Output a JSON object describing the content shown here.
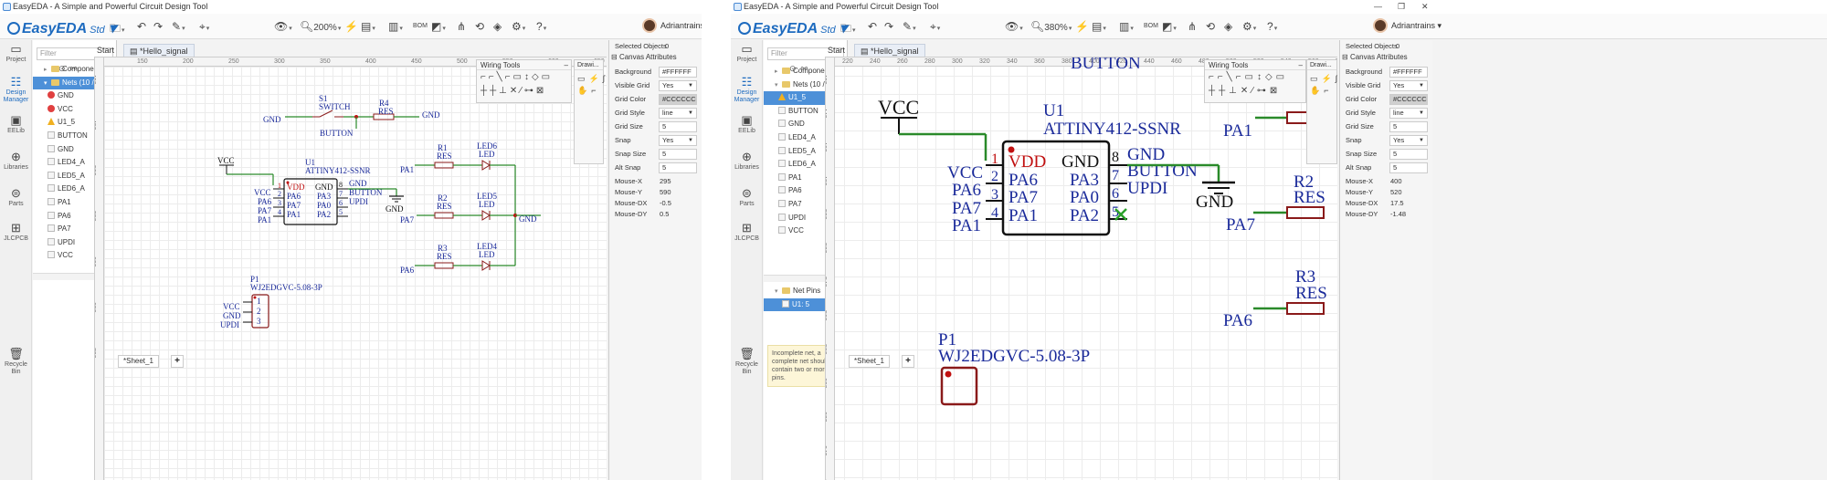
{
  "title": "EasyEDA - A Simple and Powerful Circuit Design Tool",
  "logo": {
    "name": "EasyEDA",
    "edition": "Std"
  },
  "toolbar": {
    "left_zoom": "200%",
    "right_zoom": "380%",
    "bom": "BOM"
  },
  "user": "Adriantrains",
  "nav": [
    {
      "label": "Project",
      "icon": "folder-icon"
    },
    {
      "label": "Design Manager",
      "icon": "design-manager-icon"
    },
    {
      "label": "EELib",
      "icon": "chip-icon"
    },
    {
      "label": "Libraries",
      "icon": "search-icon"
    },
    {
      "label": "Parts",
      "icon": "parts-icon"
    },
    {
      "label": "JLCPCB",
      "icon": "jlcpcb-icon"
    },
    {
      "label": "Recycle Bin",
      "icon": "trash-icon"
    }
  ],
  "filter_placeholder": "Filter",
  "left": {
    "components": "Components (10)",
    "nets": "Nets (10 / 13)",
    "net_items": [
      {
        "label": "GND",
        "state": "error"
      },
      {
        "label": "VCC",
        "state": "error"
      },
      {
        "label": "U1_5",
        "state": "warn"
      },
      {
        "label": "BUTTON",
        "state": ""
      },
      {
        "label": "GND",
        "state": ""
      },
      {
        "label": "LED4_A",
        "state": ""
      },
      {
        "label": "LED5_A",
        "state": ""
      },
      {
        "label": "LED6_A",
        "state": ""
      },
      {
        "label": "PA1",
        "state": ""
      },
      {
        "label": "PA6",
        "state": ""
      },
      {
        "label": "PA7",
        "state": ""
      },
      {
        "label": "UPDI",
        "state": ""
      },
      {
        "label": "VCC",
        "state": ""
      }
    ]
  },
  "right": {
    "components": "Components (10)",
    "nets": "Nets (10 / 11)",
    "net_items": [
      {
        "label": "U1_5",
        "state": "warn",
        "selected": true
      },
      {
        "label": "BUTTON",
        "state": ""
      },
      {
        "label": "GND",
        "state": ""
      },
      {
        "label": "LED4_A",
        "state": ""
      },
      {
        "label": "LED5_A",
        "state": ""
      },
      {
        "label": "LED6_A",
        "state": ""
      },
      {
        "label": "PA1",
        "state": ""
      },
      {
        "label": "PA6",
        "state": ""
      },
      {
        "label": "PA7",
        "state": ""
      },
      {
        "label": "UPDI",
        "state": ""
      },
      {
        "label": "VCC",
        "state": ""
      }
    ],
    "net_pins": "Net Pins",
    "net_pin_item": "U1: 5",
    "warning": "Incomplete net, a complete net should contain two or more pins."
  },
  "tabs": {
    "start": "Start",
    "doc": "*Hello_signal"
  },
  "sheet": "*Sheet_1",
  "panels": {
    "wiring_tools": "Wiring Tools",
    "drawing_tools": "Drawi..."
  },
  "props": {
    "selected_label": "Selected Objects",
    "selected_value": "0",
    "canvas_attrs": "Canvas Attributes",
    "rows": [
      {
        "label": "Background",
        "value": "#FFFFFF"
      },
      {
        "label": "Visible Grid",
        "value": "Yes"
      },
      {
        "label": "Grid Color",
        "value": "#CCCCCC"
      },
      {
        "label": "Grid Style",
        "value": "line"
      },
      {
        "label": "Grid Size",
        "value": "5"
      },
      {
        "label": "Snap",
        "value": "Yes"
      },
      {
        "label": "Snap Size",
        "value": "5"
      },
      {
        "label": "Alt Snap",
        "value": "5"
      }
    ],
    "mouse_labels": [
      "Mouse-X",
      "Mouse-Y",
      "Mouse-DX",
      "Mouse-DY"
    ],
    "left_mouse": [
      "295",
      "590",
      "-0.5",
      "0.5"
    ],
    "right_mouse": [
      "400",
      "520",
      "17.5",
      "-1.48"
    ]
  },
  "rulers": {
    "left_h": [
      "150",
      "200",
      "250",
      "300",
      "350",
      "400",
      "450",
      "500",
      "550",
      "600",
      "650"
    ],
    "left_v": [
      "400",
      "450",
      "500",
      "550",
      "600",
      "650",
      "700"
    ],
    "right_h": [
      "220",
      "240",
      "260",
      "280",
      "300",
      "320",
      "340",
      "360",
      "380",
      "400",
      "420",
      "440",
      "460",
      "480",
      "500",
      "520",
      "540",
      "560",
      "580"
    ],
    "right_v": [
      "420",
      "440",
      "460",
      "480",
      "500",
      "520",
      "540",
      "560",
      "580",
      "600",
      "620",
      "640",
      "660"
    ]
  },
  "schematic": {
    "gnd": "GND",
    "vcc": "VCC",
    "s1_ref": "S1",
    "s1_name": "SWITCH",
    "r4_ref": "R4",
    "res": "RES",
    "button": "BUTTON",
    "u1_ref": "U1",
    "u1_name": "ATTINY412-SSNR",
    "u1_pins_left": [
      "VDD",
      "PA6",
      "PA7",
      "PA1"
    ],
    "u1_pins_right": [
      "GND",
      "PA3",
      "PA0",
      "PA2"
    ],
    "u1_nums_left": [
      "1",
      "2",
      "3",
      "4"
    ],
    "u1_nums_right": [
      "8",
      "7",
      "6",
      "5"
    ],
    "u1_nets_left": [
      "VCC",
      "PA6",
      "PA7",
      "PA1"
    ],
    "u1_nets_right": [
      "GND",
      "BUTTON",
      "UPDI"
    ],
    "r1_ref": "R1",
    "r2_ref": "R2",
    "r3_ref": "R3",
    "led6": "LED6",
    "led5": "LED5",
    "led4": "LED4",
    "led": "LED",
    "pa1": "PA1",
    "pa7": "PA7",
    "pa6": "PA6",
    "p1_ref": "P1",
    "p1_name": "WJ2EDGVC-5.08-3P",
    "p1_nets": [
      "VCC",
      "GND",
      "UPDI"
    ],
    "p1_nums": [
      "1",
      "2",
      "3"
    ]
  }
}
